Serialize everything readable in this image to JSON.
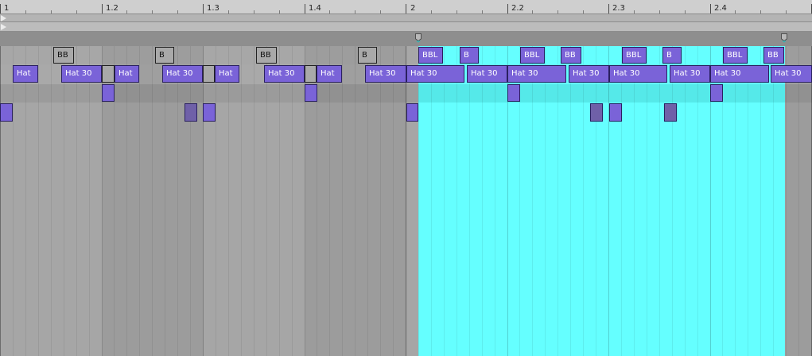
{
  "ruler": {
    "labels": [
      "1",
      "1.2",
      "1.3",
      "1.4",
      "2",
      "2.2",
      "2.3",
      "2.4"
    ]
  },
  "colors": {
    "selection": "#65ffff",
    "clip_purple": "#7a63d8",
    "clip_gray": "#a9a9a9",
    "background": "#a6a6a6"
  },
  "icons": {
    "loop_start": "loop-start-marker-icon",
    "loop_end": "loop-end-marker-icon",
    "play": "play-triangle-icon"
  },
  "lanes": {
    "bb": {
      "clips": [
        {
          "label": "BB",
          "style": "gray"
        },
        {
          "label": "B",
          "style": "gray"
        },
        {
          "label": "BB",
          "style": "gray"
        },
        {
          "label": "B",
          "style": "gray"
        },
        {
          "label": "BBL",
          "style": "purple"
        },
        {
          "label": "B",
          "style": "purple"
        },
        {
          "label": "BBL",
          "style": "purple"
        },
        {
          "label": "BB",
          "style": "purple"
        },
        {
          "label": "BBL",
          "style": "purple"
        },
        {
          "label": "B",
          "style": "purple"
        },
        {
          "label": "BBL",
          "style": "purple"
        },
        {
          "label": "BB",
          "style": "purple"
        }
      ]
    },
    "hat": {
      "clips": [
        {
          "label": "Hat",
          "style": "purple"
        },
        {
          "label": "Hat 30",
          "style": "purple"
        },
        {
          "label": "",
          "style": "gray"
        },
        {
          "label": "Hat",
          "style": "purple"
        },
        {
          "label": "Hat 30",
          "style": "purple"
        },
        {
          "label": "",
          "style": "gray"
        },
        {
          "label": "Hat",
          "style": "purple"
        },
        {
          "label": "Hat 30",
          "style": "purple"
        },
        {
          "label": "",
          "style": "gray"
        },
        {
          "label": "Hat",
          "style": "purple"
        },
        {
          "label": "Hat 30",
          "style": "purple"
        },
        {
          "label": "Hat 30",
          "style": "purple"
        },
        {
          "label": "Hat 30",
          "style": "purple"
        },
        {
          "label": "Hat 30",
          "style": "purple"
        },
        {
          "label": "Hat 30",
          "style": "purple"
        },
        {
          "label": "Hat 30",
          "style": "purple"
        },
        {
          "label": "Hat 30",
          "style": "purple"
        },
        {
          "label": "Hat 30",
          "style": "purple"
        },
        {
          "label": "Hat 30",
          "style": "purple"
        }
      ]
    }
  }
}
